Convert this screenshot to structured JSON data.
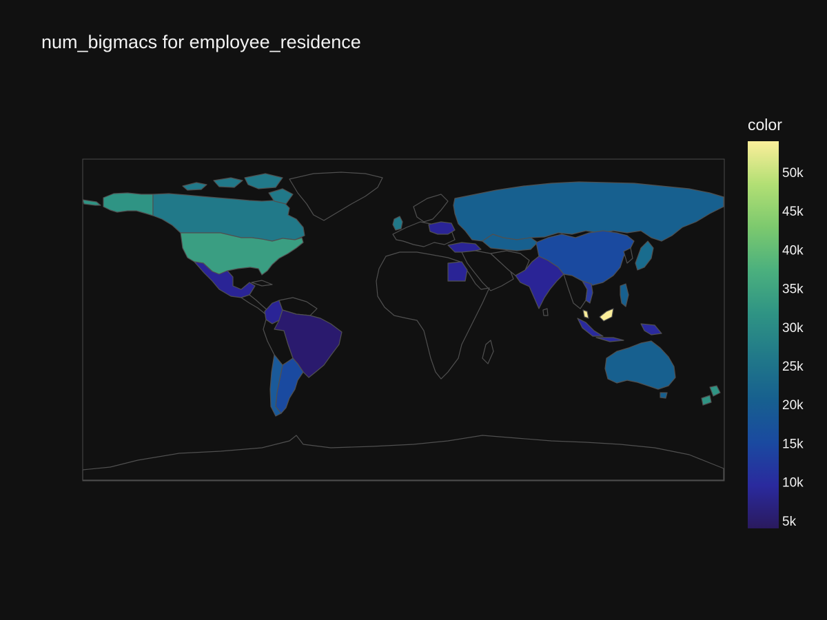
{
  "title": "num_bigmacs for employee_residence",
  "colorbar": {
    "title": "color",
    "min": 4000,
    "max": 54000,
    "ticks": [
      {
        "value": 5000,
        "label": "5k"
      },
      {
        "value": 10000,
        "label": "10k"
      },
      {
        "value": 15000,
        "label": "15k"
      },
      {
        "value": 20000,
        "label": "20k"
      },
      {
        "value": 25000,
        "label": "25k"
      },
      {
        "value": 30000,
        "label": "30k"
      },
      {
        "value": 35000,
        "label": "35k"
      },
      {
        "value": 40000,
        "label": "40k"
      },
      {
        "value": 45000,
        "label": "45k"
      },
      {
        "value": 50000,
        "label": "50k"
      }
    ],
    "colorscale": [
      "#2a1a5e",
      "#2a2a9e",
      "#1a4aa0",
      "#17608f",
      "#217989",
      "#2f9484",
      "#4bb07e",
      "#7cc96e",
      "#b2df74",
      "#fbee9a"
    ]
  },
  "background_color": "#111111",
  "land_color": "#111111",
  "chart_data": {
    "type": "choropleth",
    "title": "num_bigmacs for employee_residence",
    "legend_title": "color",
    "projection": "equirectangular",
    "locations": [
      {
        "name": "United States",
        "value": 30500
      },
      {
        "name": "Canada",
        "value": 26000
      },
      {
        "name": "Mexico",
        "value": 7500
      },
      {
        "name": "Colombia",
        "value": 7000
      },
      {
        "name": "Brazil",
        "value": 5500
      },
      {
        "name": "Argentina",
        "value": 15000
      },
      {
        "name": "Chile",
        "value": 14000
      },
      {
        "name": "Russia",
        "value": 20000
      },
      {
        "name": "China",
        "value": 14500
      },
      {
        "name": "India",
        "value": 8000
      },
      {
        "name": "Australia",
        "value": 20500
      },
      {
        "name": "New Zealand",
        "value": 32000
      },
      {
        "name": "Malaysia",
        "value": 54000
      },
      {
        "name": "Egypt",
        "value": 7000
      },
      {
        "name": "Turkey",
        "value": 8000
      },
      {
        "name": "Vietnam",
        "value": 11000
      },
      {
        "name": "Indonesia",
        "value": 9000
      },
      {
        "name": "Philippines",
        "value": 20000
      },
      {
        "name": "Japan",
        "value": 22000
      },
      {
        "name": "Ukraine",
        "value": 8500
      },
      {
        "name": "Kazakhstan",
        "value": 20000
      },
      {
        "name": "United Kingdom",
        "value": 24000
      },
      {
        "name": "Poland",
        "value": 9500
      }
    ]
  }
}
